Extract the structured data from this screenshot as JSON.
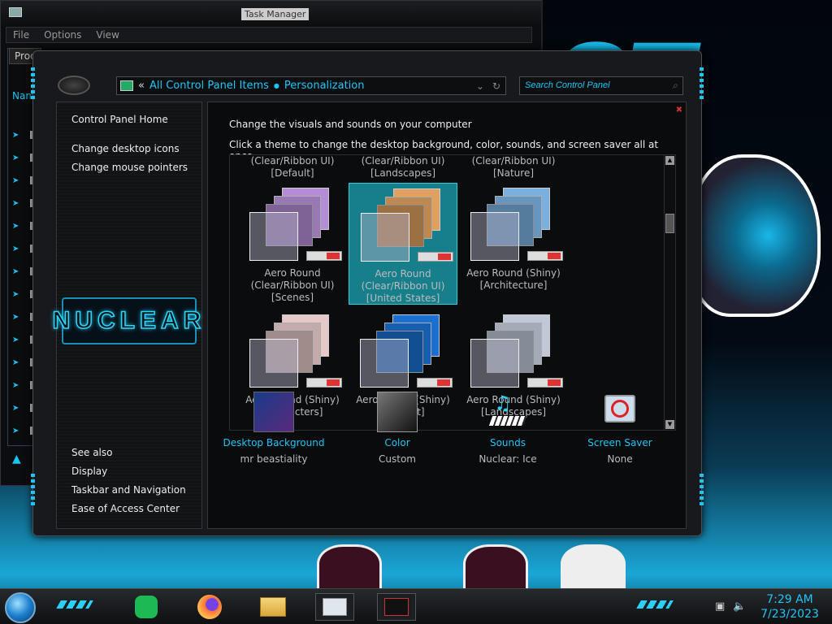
{
  "taskmgr": {
    "title": "Task Manager",
    "menu": [
      "File",
      "Options",
      "View"
    ],
    "tab": "Proc",
    "column": "Nam"
  },
  "window": {
    "address": {
      "back": "«",
      "crumbs": [
        "All Control Panel Items",
        "Personalization"
      ]
    },
    "search_placeholder": "Search Control Panel",
    "left_nav": {
      "home": "Control Panel Home",
      "links": [
        "Change desktop icons",
        "Change mouse pointers"
      ],
      "logo_text": "NUCLEAR",
      "see_also_title": "See also",
      "see_also": [
        "Display",
        "Taskbar and Navigation",
        "Ease of Access Center"
      ]
    },
    "main": {
      "title": "Change the visuals and sounds on your computer",
      "instruction": "Click a theme to change the desktop background, color, sounds, and screen saver all at once.",
      "top_row": [
        [
          "(Clear/Ribbon UI)",
          "[Default]"
        ],
        [
          "(Clear/Ribbon UI)",
          "[Landscapes]"
        ],
        [
          "(Clear/Ribbon UI)",
          "[Nature]"
        ]
      ],
      "themes": [
        {
          "l1": "Aero Round",
          "l2": "(Clear/Ribbon UI)",
          "l3": "[Scenes]",
          "color": "#b58dd6"
        },
        {
          "l1": "Aero Round",
          "l2": "(Clear/Ribbon UI)",
          "l3": "[United States]",
          "color": "#e0a060",
          "selected": true
        },
        {
          "l1": "Aero Round (Shiny)",
          "l2": "[Architecture]",
          "l3": "",
          "color": "#7ab0e0"
        },
        {
          "l1": "Aero Round (Shiny)",
          "l2": "[Characters]",
          "l3": "",
          "color": "#e6c8c8"
        },
        {
          "l1": "Aero Round (Shiny)",
          "l2": "[Default]",
          "l3": "",
          "color": "#1a6fd0"
        },
        {
          "l1": "Aero Round (Shiny)",
          "l2": "[Landscapes]",
          "l3": "",
          "color": "#c0c8d8"
        }
      ],
      "bottom": [
        {
          "link": "Desktop Background",
          "sub": "mr beastiality",
          "icon": "desktop-background-icon"
        },
        {
          "link": "Color",
          "sub": "Custom",
          "icon": "color-swatch-icon"
        },
        {
          "link": "Sounds",
          "sub": "Nuclear: Ice",
          "icon": "sounds-icon"
        },
        {
          "link": "Screen Saver",
          "sub": "None",
          "icon": "screen-saver-icon"
        }
      ]
    }
  },
  "taskbar": {
    "apps": [
      "spotify",
      "firefox",
      "file-explorer",
      "task-manager",
      "control-panel"
    ],
    "time": "7:29 AM",
    "date": "7/23/2023"
  },
  "colors": {
    "accent": "#20c6f5",
    "selected": "#177f8c"
  }
}
